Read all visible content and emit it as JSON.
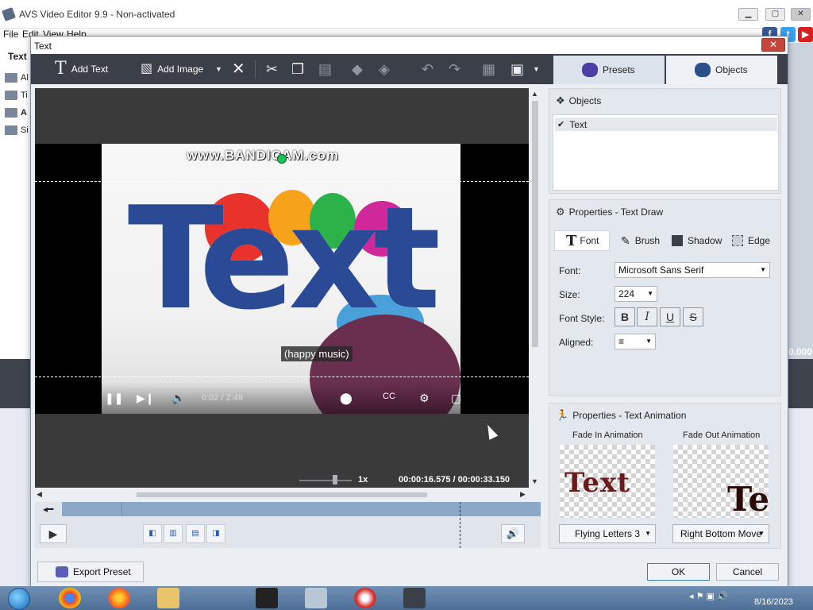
{
  "app": {
    "title": "AVS Video Editor 9.9 - Non-activated",
    "menu": [
      "File",
      "Edit",
      "View",
      "Help"
    ],
    "left_pane_title": "Text",
    "left_pane_items": [
      "Al",
      "Ti",
      "A",
      "Si"
    ],
    "right_time_fragment": "0.000"
  },
  "dialog": {
    "title": "Text",
    "close_label": "✕",
    "toolbar": {
      "add_text": "Add Text",
      "add_image": "Add Image"
    },
    "tabs": {
      "presets": "Presets",
      "objects": "Objects"
    },
    "preview": {
      "watermark": "www.BANDICAM.com",
      "big_text": "Text",
      "caption": "(happy music)",
      "yt_time": "0:02 / 2:49",
      "speed": "1x",
      "timecode": "00:00:16.575  /  00:00:33.150"
    },
    "objects_panel": {
      "title": "Objects",
      "items": [
        {
          "label": "Text",
          "checked": true
        }
      ]
    },
    "properties_panel": {
      "title": "Properties - Text Draw",
      "tabs": [
        "Font",
        "Brush",
        "Shadow",
        "Edge"
      ],
      "font_label": "Font:",
      "font_value": "Microsoft Sans Serif",
      "size_label": "Size:",
      "size_value": "224",
      "font_style_label": "Font Style:",
      "style_buttons": [
        "B",
        "I",
        "U",
        "S"
      ],
      "aligned_label": "Aligned:",
      "aligned_value": "≡"
    },
    "animation_panel": {
      "title": "Properties - Text Animation",
      "fade_in_label": "Fade In Animation",
      "fade_out_label": "Fade Out Animation",
      "fade_in_preview": "Text",
      "fade_out_preview": "Te",
      "fade_in_value": "Flying Letters 3",
      "fade_out_value": "Right Bottom Move"
    },
    "buttons": {
      "export_preset": "Export Preset",
      "ok": "OK",
      "cancel": "Cancel"
    }
  },
  "taskbar": {
    "date": "8/16/2023"
  },
  "colors": {
    "toolbar_bg": "#3b4048",
    "text_blue": "#2b4a95",
    "handle_green": "#19c35a",
    "close_red": "#c7463c",
    "timeline_track": "#8ca8c9"
  }
}
